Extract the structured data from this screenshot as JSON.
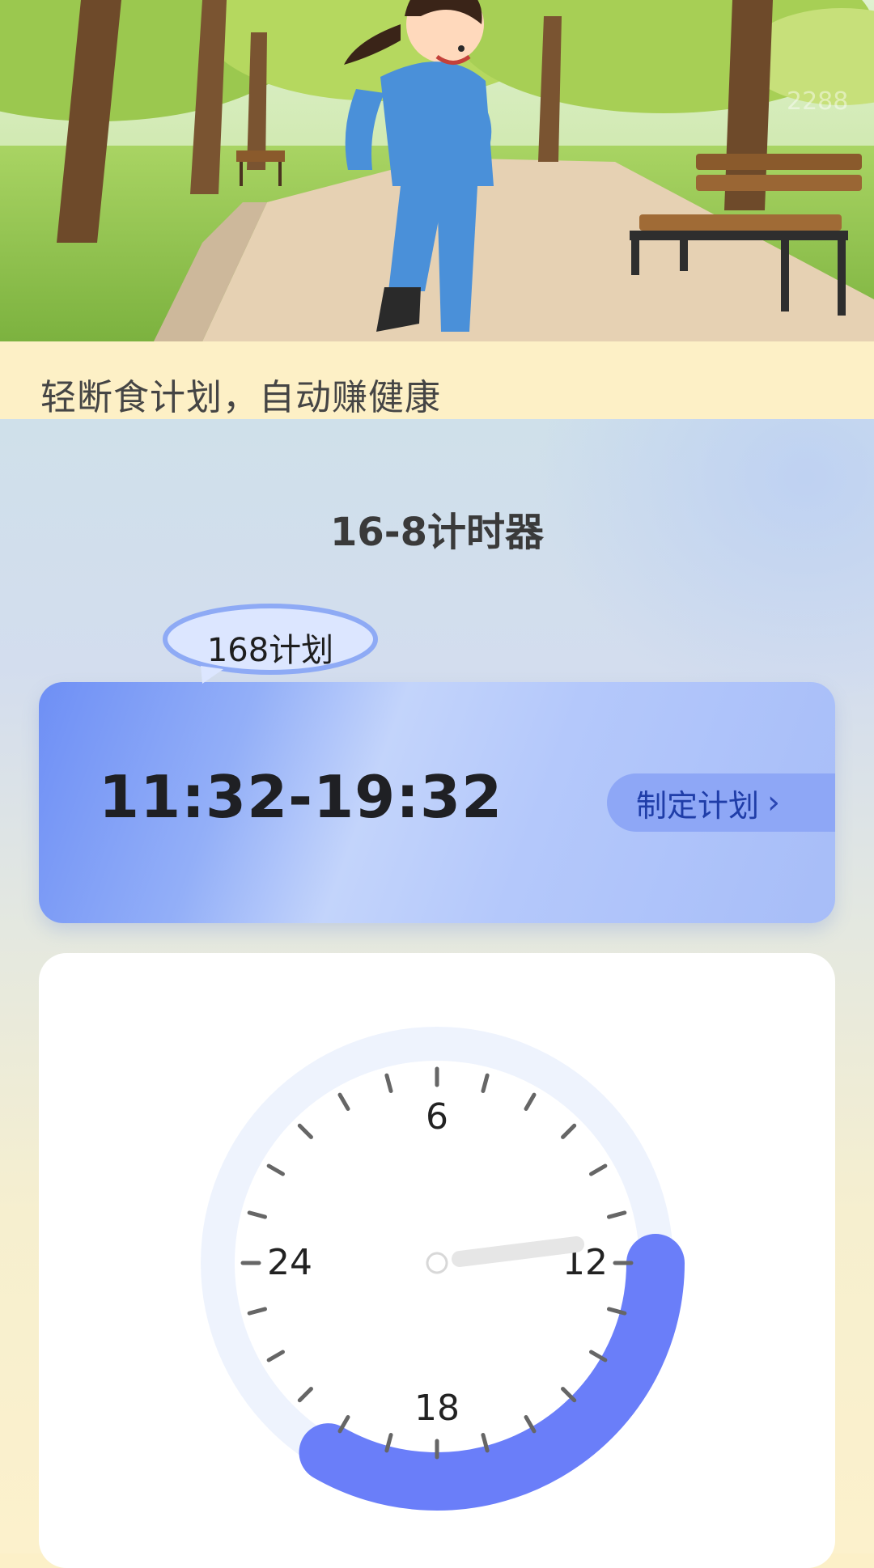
{
  "hero": {
    "watermark": "2288"
  },
  "slogan": "轻断食计划，自动赚健康",
  "timer": {
    "title": "16-8计时器",
    "plan_badge": "168计划",
    "time_range": "11:32-19:32",
    "make_plan_button": "制定计划",
    "chevron_icon": "chevron-right-icon"
  },
  "clock": {
    "labels": {
      "top": "6",
      "right": "12",
      "bottom": "18",
      "left": "24"
    },
    "progress_fraction": 0.333,
    "colors": {
      "ring": "#eef3fd",
      "progress": "#6a7ef9",
      "hand": "#e6e6e6",
      "tick": "#666666"
    }
  },
  "colors": {
    "page_bg": "#fcf0c8",
    "card_accent": "#8ea7f6",
    "button_text": "#1f3da8"
  }
}
